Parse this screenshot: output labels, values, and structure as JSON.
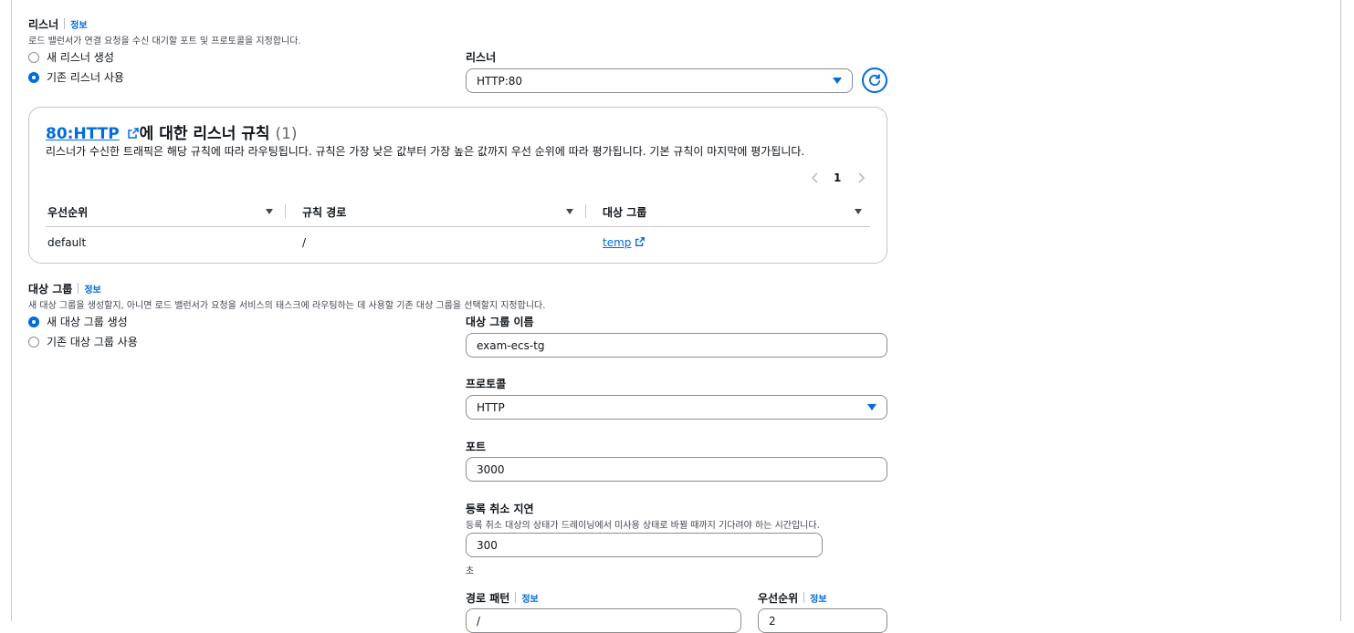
{
  "listener_section": {
    "title": "리스너",
    "info": "정보",
    "description": "로드 밸런서가 연결 요청을 수신 대기할 포트 및 프로토콜을 지정합니다.",
    "options": [
      "새 리스너 생성",
      "기존 리스너 사용"
    ],
    "selected_index": 1,
    "select_label": "리스너",
    "select_value": "HTTP:80"
  },
  "rules_panel": {
    "title_link": "80:HTTP",
    "title_rest": "에 대한 리스너 규칙",
    "count": "(1)",
    "description": "리스너가 수신한 트래픽은 해당 규칙에 따라 라우팅됩니다. 규칙은 가장 낮은 값부터 가장 높은 값까지 우선 순위에 따라 평가됩니다. 기본 규칙이 마지막에 평가됩니다.",
    "page_current": "1",
    "columns": [
      "우선순위",
      "규칙 경로",
      "대상 그룹"
    ],
    "rows": [
      {
        "priority": "default",
        "path": "/",
        "target": "temp"
      }
    ]
  },
  "target_group_section": {
    "title": "대상 그룹",
    "info": "정보",
    "description": "새 대상 그룹을 생성할지, 아니면 로드 밸런서가 요청을 서비스의 태스크에 라우팅하는 데 사용할 기존 대상 그룹을 선택할지 지정합니다.",
    "options": [
      "새 대상 그룹 생성",
      "기존 대상 그룹 사용"
    ],
    "selected_index": 0,
    "name_label": "대상 그룹 이름",
    "name_value": "exam-ecs-tg",
    "protocol_label": "프로토콜",
    "protocol_value": "HTTP",
    "port_label": "포트",
    "port_value": "3000",
    "dereg_label": "등록 취소 지연",
    "dereg_description": "등록 취소 대상의 상태가 드레이닝에서 미사용 상태로 바뀔 때까지 기다려야 하는 시간입니다.",
    "dereg_value": "300",
    "dereg_unit": "초",
    "path_label": "경로 패턴",
    "path_info": "정보",
    "path_value": "/",
    "priority_label": "우선순위",
    "priority_info": "정보",
    "priority_value": "2"
  },
  "colors": {
    "accent": "#006ce0",
    "border": "#8c8c94",
    "text": "#0f141a"
  }
}
